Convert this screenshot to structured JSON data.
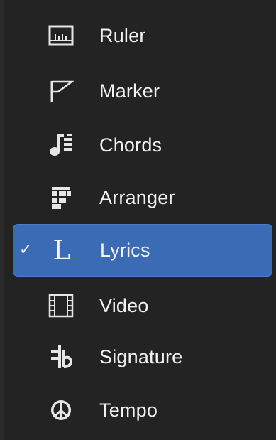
{
  "menu": {
    "items": [
      {
        "label": "Ruler",
        "icon": "ruler-icon",
        "checked": false
      },
      {
        "label": "Marker",
        "icon": "marker-flag-icon",
        "checked": false
      },
      {
        "label": "Chords",
        "icon": "chords-icon",
        "checked": false
      },
      {
        "label": "Arranger",
        "icon": "arranger-icon",
        "checked": false
      },
      {
        "label": "Lyrics",
        "icon": "lyrics-icon",
        "checked": true
      },
      {
        "label": "Video",
        "icon": "video-film-icon",
        "checked": false
      },
      {
        "label": "Signature",
        "icon": "signature-icon",
        "checked": false
      },
      {
        "label": "Tempo",
        "icon": "tempo-icon",
        "checked": false
      }
    ],
    "check_glyph": "✓",
    "lyrics_glyph": "L",
    "colors": {
      "background": "#232323",
      "selected": "#3c6bb5",
      "text": "#f1f1f1",
      "icon": "#e6e6e6"
    }
  }
}
